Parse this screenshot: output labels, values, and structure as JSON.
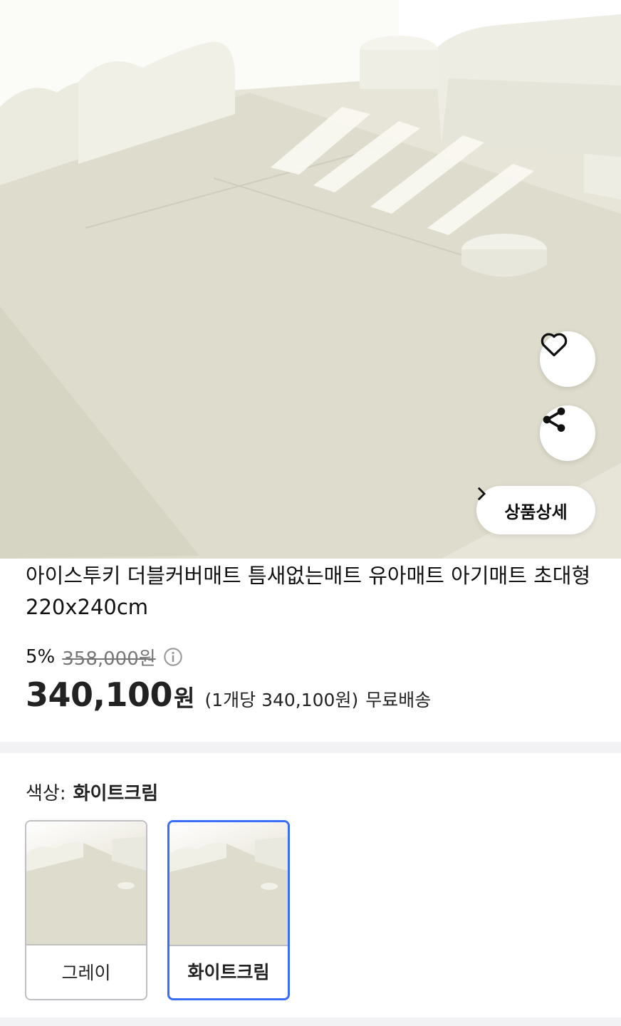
{
  "product": {
    "title": "아이스투키 더블커버매트 틈새없는매트 유아매트 아기매트 초대형 220x240cm",
    "hero_image": "image-of-cream-floor-mat-with-sofa",
    "detail_button_label": "상품상세"
  },
  "price": {
    "discount_rate": "5%",
    "original_price": "358,000원",
    "sale_price": "340,100",
    "sale_currency": "원",
    "unit_price": "(1개당 340,100원)",
    "shipping": "무료배송"
  },
  "option": {
    "label": "색상:",
    "selected_value": "화이트크림",
    "choices": [
      {
        "name": "그레이",
        "selected": false
      },
      {
        "name": "화이트크림",
        "selected": true
      }
    ]
  },
  "icons": {
    "heart": "heart-icon",
    "share": "share-icon",
    "chevron": "chevron-right-icon",
    "info": "info-icon"
  },
  "colors": {
    "accent": "#3b6ef6",
    "text": "#111111",
    "muted": "#777777",
    "divider": "#f2f2f4"
  }
}
